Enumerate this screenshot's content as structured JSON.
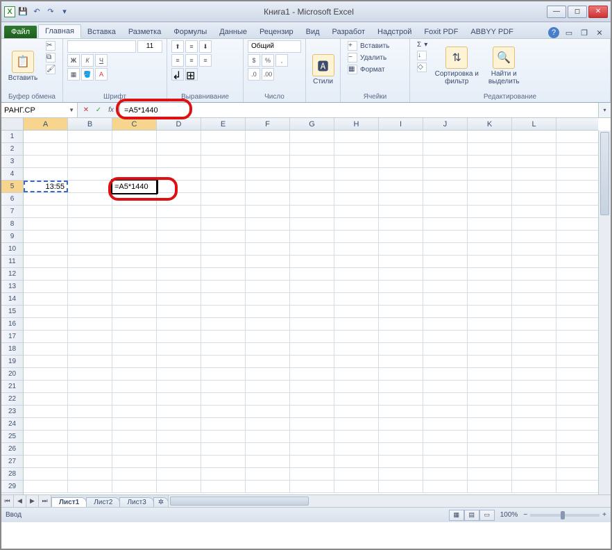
{
  "title": "Книга1  -  Microsoft Excel",
  "qat": {
    "x_icon": "X",
    "save": "💾",
    "undo": "↶",
    "redo": "↷"
  },
  "tabs": {
    "file": "Файл",
    "items": [
      "Главная",
      "Вставка",
      "Разметка",
      "Формулы",
      "Данные",
      "Рецензир",
      "Вид",
      "Разработ",
      "Надстрой",
      "Foxit PDF",
      "ABBYY PDF"
    ],
    "active_index": 0
  },
  "ribbon": {
    "clipboard": {
      "paste": "Вставить",
      "label": "Буфер обмена"
    },
    "font": {
      "label": "Шрифт",
      "size": "11"
    },
    "align": {
      "label": "Выравнивание"
    },
    "number": {
      "format": "Общий",
      "label": "Число"
    },
    "styles": {
      "btn": "Стили",
      "label": ""
    },
    "cells": {
      "insert": "Вставить",
      "delete": "Удалить",
      "format": "Формат",
      "label": "Ячейки"
    },
    "editing": {
      "sigma": "Σ",
      "sort": "Сортировка и фильтр",
      "find": "Найти и выделить",
      "label": "Редактирование"
    }
  },
  "namebox": "РАНГ.СР",
  "formula": "=A5*1440",
  "columns": [
    "A",
    "B",
    "C",
    "D",
    "E",
    "F",
    "G",
    "H",
    "I",
    "J",
    "K",
    "L"
  ],
  "row_count": 29,
  "cells": {
    "A5": "13:55",
    "C5_edit": "=A5*1440"
  },
  "sheets": {
    "items": [
      "Лист1",
      "Лист2",
      "Лист3"
    ],
    "active": 0
  },
  "status": {
    "mode": "Ввод",
    "zoom": "100%"
  }
}
